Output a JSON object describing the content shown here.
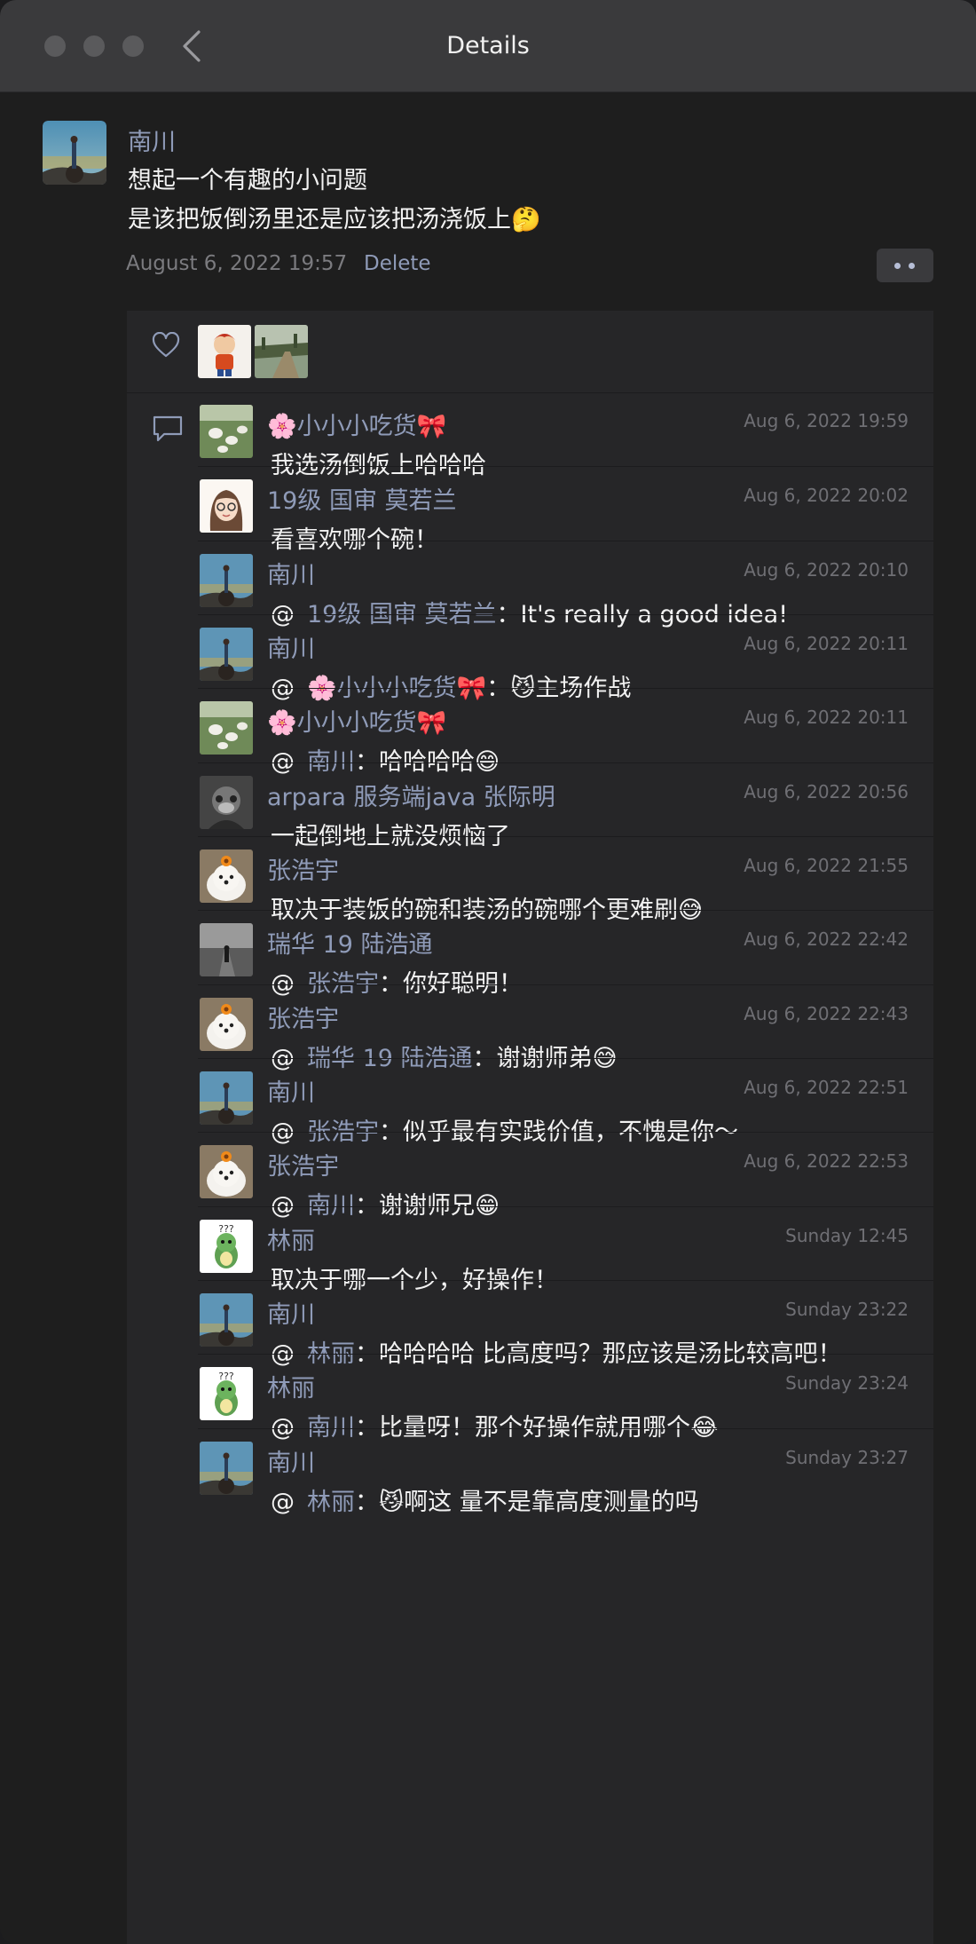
{
  "window": {
    "title": "Details"
  },
  "post": {
    "author": "南川",
    "lines": [
      "想起一个有趣的小问题",
      "是该把饭倒汤里还是应该把汤浇饭上🤔"
    ],
    "timestamp": "August 6, 2022 19:57",
    "delete_label": "Delete"
  },
  "likes": [
    {
      "avatar": "cartoon-boy-avatar"
    },
    {
      "avatar": "landscape-avatar"
    }
  ],
  "comments": [
    {
      "author": "🌸小小小吃货🎀",
      "time": "Aug 6, 2022 19:59",
      "mention": "",
      "text": "我选汤倒饭上哈哈哈",
      "avatar": "dogs-on-grass"
    },
    {
      "author": "19级 国审 莫若兰",
      "time": "Aug 6, 2022 20:02",
      "mention": "",
      "text": "看喜欢哪个碗！",
      "avatar": "girl-cartoon"
    },
    {
      "author": "南川",
      "time": "Aug 6, 2022 20:10",
      "mention": "19级 国审 莫若兰",
      "text": "It's really a good idea!",
      "avatar": "nanchuan"
    },
    {
      "author": "南川",
      "time": "Aug 6, 2022 20:11",
      "mention": "🌸小小小吃货🎀",
      "text": "😼主场作战",
      "avatar": "nanchuan"
    },
    {
      "author": "🌸小小小吃货🎀",
      "time": "Aug 6, 2022 20:11",
      "mention": "南川",
      "text": "哈哈哈哈😄",
      "avatar": "dogs-on-grass"
    },
    {
      "author": "arpara 服务端java 张际明",
      "time": "Aug 6, 2022 20:56",
      "mention": "",
      "text": "一起倒地上就没烦恼了",
      "avatar": "monkey-bw"
    },
    {
      "author": "张浩宇",
      "time": "Aug 6, 2022 21:55",
      "mention": "",
      "text": "取决于装饭的碗和装汤的碗哪个更难刷😅",
      "avatar": "white-dog"
    },
    {
      "author": "瑞华 19 陆浩通",
      "time": "Aug 6, 2022 22:42",
      "mention": "张浩宇",
      "text": "你好聪明！",
      "avatar": "road-bw"
    },
    {
      "author": "张浩宇",
      "time": "Aug 6, 2022 22:43",
      "mention": "瑞华 19 陆浩通",
      "text": "谢谢师弟😅",
      "avatar": "white-dog"
    },
    {
      "author": "南川",
      "time": "Aug 6, 2022 22:51",
      "mention": "张浩宇",
      "text": "似乎最有实践价值，不愧是你～",
      "avatar": "nanchuan"
    },
    {
      "author": "张浩宇",
      "time": "Aug 6, 2022 22:53",
      "mention": "南川",
      "text": "谢谢师兄😁",
      "avatar": "white-dog"
    },
    {
      "author": "林丽",
      "time": "Sunday 12:45",
      "mention": "",
      "text": "取决于哪一个少，好操作！",
      "avatar": "dino"
    },
    {
      "author": "南川",
      "time": "Sunday 23:22",
      "mention": "林丽",
      "text": "哈哈哈哈 比高度吗？那应该是汤比较高吧！",
      "avatar": "nanchuan"
    },
    {
      "author": "林丽",
      "time": "Sunday 23:24",
      "mention": "南川",
      "text": "比量呀！那个好操作就用哪个😂",
      "avatar": "dino"
    },
    {
      "author": "南川",
      "time": "Sunday 23:27",
      "mention": "林丽",
      "text": "😼啊这 量不是靠高度测量的吗",
      "avatar": "nanchuan"
    }
  ]
}
